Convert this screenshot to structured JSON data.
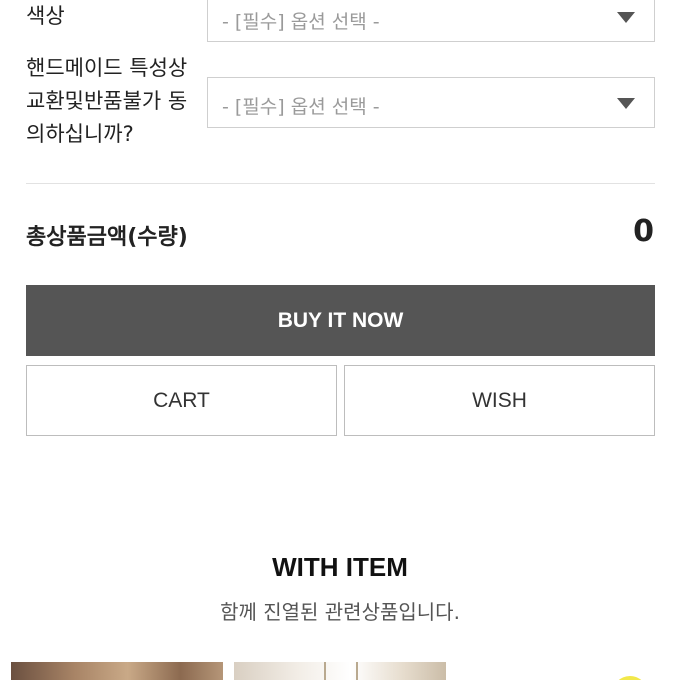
{
  "options": [
    {
      "label_lines": [
        "색상"
      ],
      "placeholder": "- [필수] 옵션 선택 -"
    },
    {
      "label_lines": [
        "핸드메이드 특성상",
        "교환및반품불가 동",
        "의하십니까?"
      ],
      "placeholder": "- [필수] 옵션 선택 -"
    }
  ],
  "total": {
    "label": "총상품금액(수량)",
    "value": "0"
  },
  "buttons": {
    "buy": "BUY IT NOW",
    "cart": "CART",
    "wish": "WISH"
  },
  "with_item": {
    "title": "WITH ITEM",
    "subtitle": "함께 진열된 관련상품입니다."
  },
  "colors": {
    "buy_bg": "#555555",
    "border": "#cfcfcf",
    "placeholder": "#9a9a9a"
  },
  "icons": {
    "select_caret": "chevron-down-icon"
  }
}
